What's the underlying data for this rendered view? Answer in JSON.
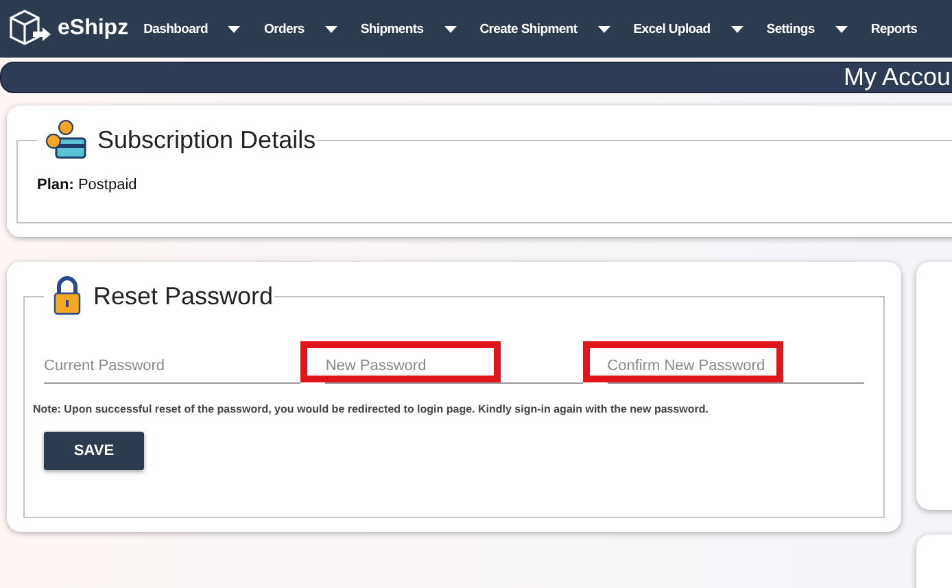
{
  "brand": "eShipz",
  "nav": [
    {
      "label": "Dashboard",
      "dropdown": true
    },
    {
      "label": "Orders",
      "dropdown": true
    },
    {
      "label": "Shipments",
      "dropdown": true
    },
    {
      "label": "Create Shipment",
      "dropdown": true
    },
    {
      "label": "Excel Upload",
      "dropdown": true
    },
    {
      "label": "Settings",
      "dropdown": true
    },
    {
      "label": "Reports",
      "dropdown": false
    }
  ],
  "page_title": "My Accou",
  "subscription": {
    "title": "Subscription Details",
    "plan_label": "Plan:",
    "plan_value": "Postpaid"
  },
  "reset": {
    "title": "Reset Password",
    "fields": [
      {
        "placeholder": "Current Password",
        "highlighted": false
      },
      {
        "placeholder": "New Password",
        "highlighted": true
      },
      {
        "placeholder": "Confirm New Password",
        "highlighted": true
      }
    ],
    "note": "Note: Upon successful reset of the password, you would be redirected to login page. Kindly sign-in again with the new password.",
    "button": "SAVE"
  }
}
